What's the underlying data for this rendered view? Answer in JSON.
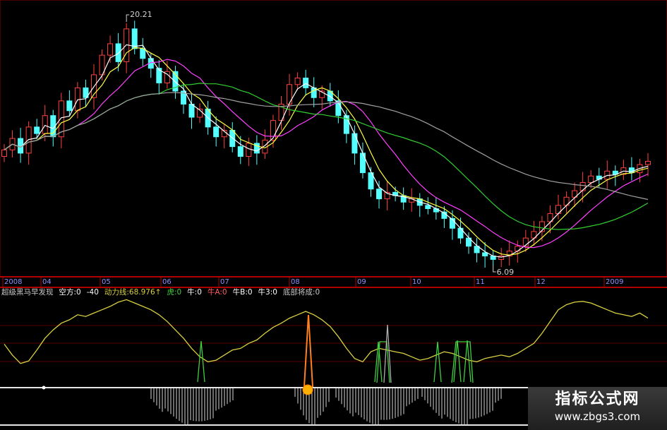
{
  "chart_data": [
    {
      "type": "candlestick",
      "x_ticks": [
        "2008",
        "04",
        "05",
        "06",
        "07",
        "08",
        "09",
        "10",
        "11",
        "12",
        "2009"
      ],
      "annotations": {
        "high": "20.21",
        "low": "6.09"
      },
      "series": [
        {
          "name": "price",
          "values": [
            12.8,
            13.5,
            12.6,
            14.2,
            13.8,
            14.9,
            13.6,
            15.8,
            15.2,
            16.6,
            16.0,
            17.4,
            18.6,
            19.3,
            18.2,
            20.21,
            19.0,
            18.4,
            17.8,
            16.9,
            17.6,
            16.4,
            15.6,
            14.8,
            15.3,
            14.2,
            13.6,
            14.0,
            13.0,
            12.4,
            13.2,
            12.6,
            13.4,
            14.6,
            15.6,
            16.8,
            17.2,
            16.6,
            16.0,
            16.4,
            15.8,
            14.9,
            13.8,
            12.6,
            11.4,
            10.4,
            9.8,
            10.2,
            10.0,
            9.6,
            9.8,
            9.4,
            9.2,
            9.0,
            8.6,
            8.0,
            7.4,
            6.9,
            6.5,
            6.3,
            6.09,
            6.3,
            6.6,
            6.9,
            7.4,
            7.8,
            8.4,
            8.9,
            9.4,
            9.9,
            10.3,
            10.8,
            11.2,
            11.0,
            11.5,
            11.3,
            11.7,
            11.4,
            11.9,
            12.1
          ]
        }
      ]
    },
    {
      "type": "line",
      "legend": [
        {
          "label": "超级黑马早发现",
          "color": "#c8c8c8"
        },
        {
          "label": "空方:0",
          "color": "#ffffff"
        },
        {
          "label": "-40",
          "color": "#ffffff"
        },
        {
          "label": "动力线:68.976↑",
          "color": "#d8d040"
        },
        {
          "label": "虎:0",
          "color": "#40d040"
        },
        {
          "label": "牛:0",
          "color": "#ffffff"
        },
        {
          "label": "牛A:0",
          "color": "#ff6060"
        },
        {
          "label": "牛B:0",
          "color": "#ffffff"
        },
        {
          "label": "牛3:0",
          "color": "#ffffff"
        },
        {
          "label": "底部将成:0",
          "color": "#c8c8c8"
        }
      ],
      "series": [
        {
          "name": "动力线",
          "values": [
            45,
            32,
            22,
            25,
            38,
            52,
            62,
            70,
            74,
            80,
            78,
            82,
            86,
            90,
            95,
            98,
            94,
            90,
            86,
            80,
            72,
            62,
            52,
            40,
            30,
            24,
            26,
            32,
            38,
            40,
            46,
            50,
            58,
            65,
            70,
            76,
            80,
            84,
            80,
            74,
            66,
            54,
            40,
            28,
            24,
            36,
            40,
            38,
            36,
            34,
            30,
            26,
            28,
            32,
            36,
            34,
            30,
            26,
            24,
            28,
            30,
            32,
            30,
            34,
            40,
            46,
            58,
            72,
            86,
            92,
            95,
            96,
            94,
            90,
            86,
            82,
            80,
            78,
            82,
            76
          ]
        }
      ]
    }
  ],
  "watermark": {
    "title": "指标公式网",
    "url": "www.zbgs3.com"
  }
}
